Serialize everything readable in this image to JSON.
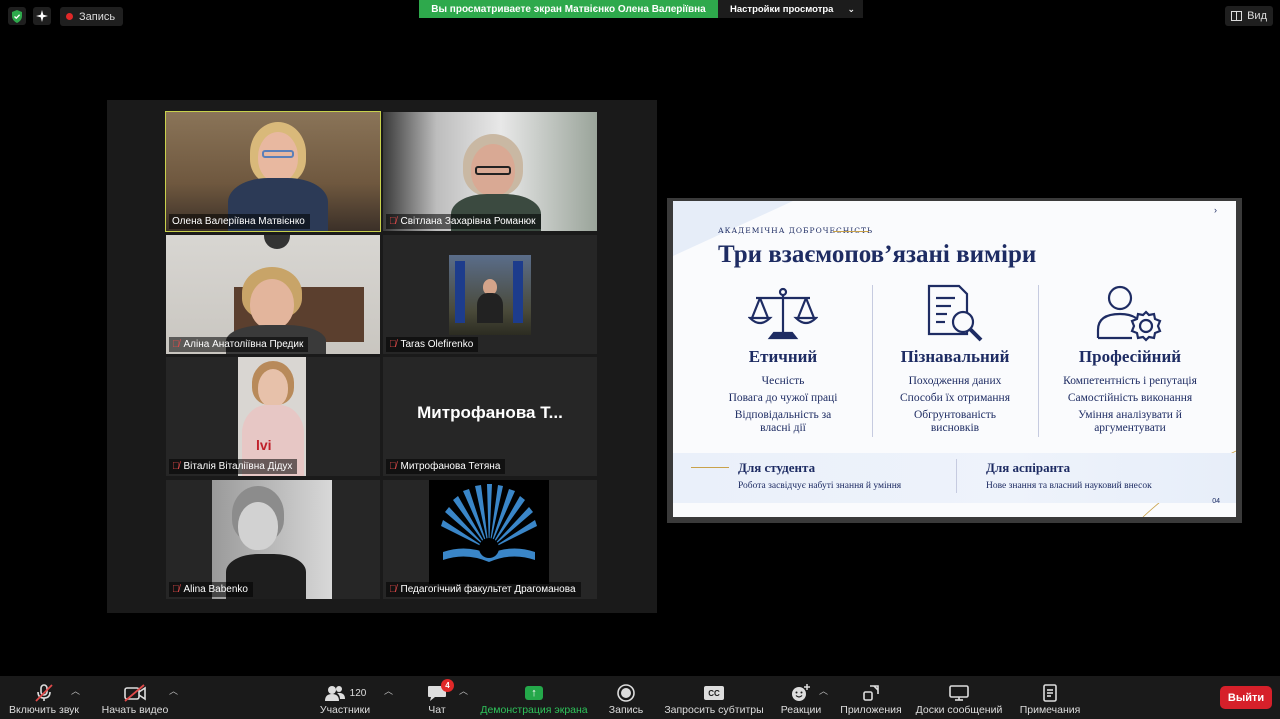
{
  "top": {
    "record_label": "Запись",
    "share_banner": "Вы просматриваете экран Матвієнко Олена Валеріївна",
    "view_options_label": "Настройки просмотра",
    "view_label": "Вид"
  },
  "gallery": {
    "tiles": [
      {
        "name": "Олена Валеріївна Матвієнко",
        "muted": false,
        "active": true
      },
      {
        "name": "Світлана Захарівна Романюк",
        "muted": true
      },
      {
        "name": "Аліна Анатоліївна Предик",
        "muted": true
      },
      {
        "name": "Taras Olefirenko",
        "muted": true
      },
      {
        "name": "Віталія Віталіївна Дідух",
        "muted": true
      },
      {
        "name": "Митрофанова Тетяна",
        "muted": true,
        "display_text": "Митрофанова Т..."
      },
      {
        "name": "Alina Babenko",
        "muted": true
      },
      {
        "name": "Педагогічний факультет Драгоманова",
        "muted": true
      }
    ]
  },
  "slide": {
    "kicker": "АКАДЕМІЧНА ДОБРОЧЕСНІСТЬ",
    "title": "Три взаємопов’язані виміри",
    "columns": [
      {
        "icon": "scales-icon",
        "heading": "Етичний",
        "items": [
          "Чесність",
          "Повага до чужої праці",
          "Відповідальність за власні дії"
        ]
      },
      {
        "icon": "document-search-icon",
        "heading": "Пізнавальний",
        "items": [
          "Походження даних",
          "Способи їх отримання",
          "Обгрунтованість висновків"
        ]
      },
      {
        "icon": "user-gear-icon",
        "heading": "Професійний",
        "items": [
          "Компетентність і репутація",
          "Самостійність виконання",
          "Уміння аналізувати й аргументувати"
        ]
      }
    ],
    "bottom": [
      {
        "title": "Для студента",
        "subtitle": "Робота засвідчує набуті знання й уміння"
      },
      {
        "title": "Для аспіранта",
        "subtitle": "Нове знання та власний науковий внесок"
      }
    ],
    "page": "04",
    "accent_color": "#1e2c63",
    "gold_color": "#c9a24a"
  },
  "toolbar": {
    "audio": "Включить звук",
    "video": "Начать видео",
    "participants": "Участники",
    "participants_count": "120",
    "chat": "Чат",
    "chat_badge": "4",
    "share": "Демонстрация экрана",
    "record": "Запись",
    "captions": "Запросить субтитры",
    "captions_icon_text": "CC",
    "reactions": "Реакции",
    "apps": "Приложения",
    "whiteboards": "Доски сообщений",
    "notes": "Примечания",
    "exit": "Выйти"
  }
}
